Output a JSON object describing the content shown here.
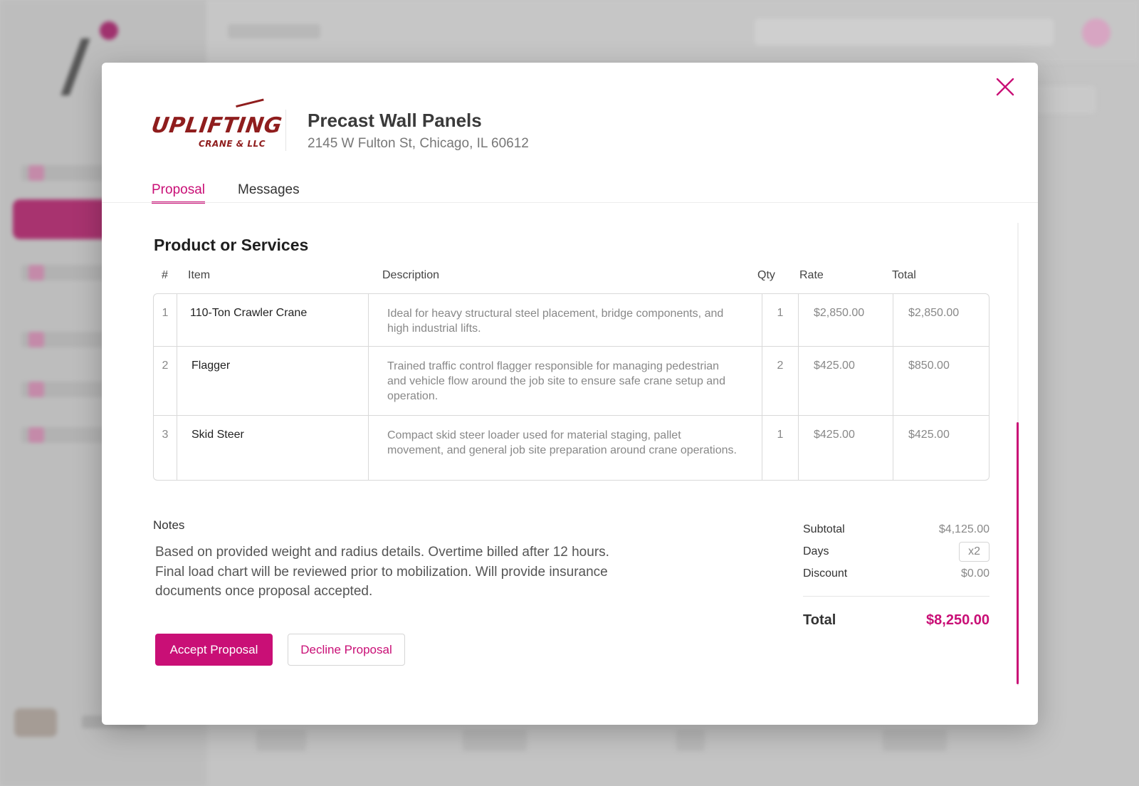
{
  "project": {
    "title": "Precast Wall Panels",
    "address": "2145 W Fulton St,  Chicago, IL 60612"
  },
  "logo": {
    "main_text": "UPLIFTING",
    "sub_text": "CRANE & LLC"
  },
  "tabs": [
    {
      "label": "Proposal",
      "active": true
    },
    {
      "label": "Messages",
      "active": false
    }
  ],
  "section_title": "Product or Services",
  "table": {
    "headers": {
      "num": "#",
      "item": "Item",
      "description": "Description",
      "qty": "Qty",
      "rate": "Rate",
      "total": "Total"
    },
    "rows": [
      {
        "num": "1",
        "item": "110-Ton Crawler Crane",
        "description": "Ideal for heavy structural steel placement, bridge components, and high industrial lifts.",
        "qty": "1",
        "rate": "$2,850.00",
        "total": "$2,850.00"
      },
      {
        "num": "2",
        "item": "Flagger",
        "description": "Trained traffic control flagger responsible for managing pedestrian and vehicle flow around the job site to ensure safe crane setup and operation.",
        "qty": "2",
        "rate": "$425.00",
        "total": "$850.00"
      },
      {
        "num": "3",
        "item": "Skid Steer",
        "description": "Compact skid steer loader used for material staging, pallet movement, and general job site preparation around crane operations.",
        "qty": "1",
        "rate": "$425.00",
        "total": "$425.00"
      }
    ]
  },
  "notes": {
    "label": "Notes",
    "text": "Based on provided weight and radius details. Overtime billed after 12 hours. Final load chart will be reviewed prior to mobilization. Will provide insurance documents once proposal accepted."
  },
  "summary": {
    "subtotal_label": "Subtotal",
    "subtotal_value": "$4,125.00",
    "days_label": "Days",
    "days_value": "x2",
    "discount_label": "Discount",
    "discount_value": "$0.00",
    "total_label": "Total",
    "total_value": "$8,250.00"
  },
  "buttons": {
    "accept": "Accept Proposal",
    "decline": "Decline Proposal"
  },
  "colors": {
    "accent": "#c90f76",
    "logo": "#8f1d1d"
  },
  "icons": {
    "close": "close-icon"
  }
}
